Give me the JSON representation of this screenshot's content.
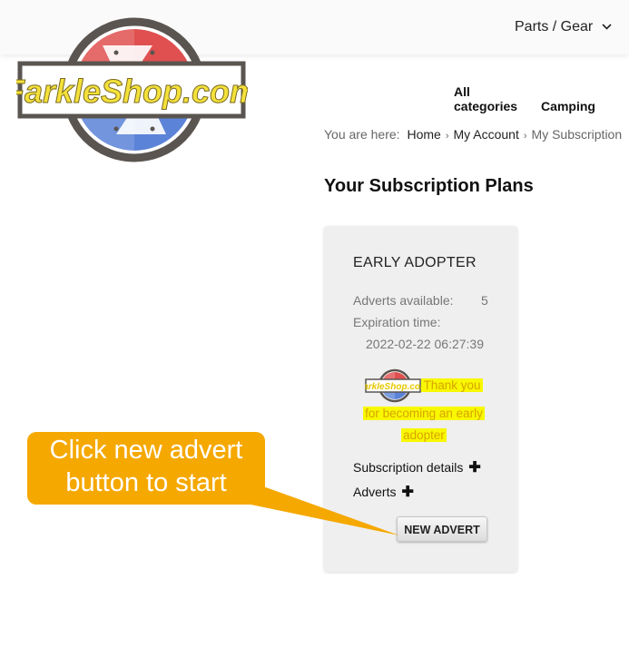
{
  "header": {
    "menu_label": "Parts / Gear",
    "chevron_icon": "chevron-down-icon"
  },
  "logo": {
    "text": "FarkleShop.com"
  },
  "nav": {
    "items": [
      "All categories",
      "Camping"
    ]
  },
  "breadcrumb": {
    "prefix": "You are here:",
    "items": [
      "Home",
      "My Account",
      "My Subscription"
    ]
  },
  "page_title": "Your Subscription Plans",
  "plan": {
    "name": "EARLY ADOPTER",
    "adverts_label": "Adverts available:",
    "adverts_value": "5",
    "expiration_label": "Expiration time:",
    "expiration_value": "2022-02-22 06:27:39",
    "thanks_line1": "Thank you",
    "thanks_line2": "for becoming an early",
    "thanks_line3": "adopter",
    "details_label": "Subscription details",
    "adverts_toggle_label": "Adverts",
    "new_advert_button": "NEW ADVERT"
  },
  "callout": {
    "line1": "Click new advert",
    "line2": "button to start",
    "color": "#f5a800"
  },
  "colors": {
    "card_bg": "#efefef",
    "highlight": "#f8f800",
    "logo_red": "#e05050",
    "logo_blue": "#5b83d8",
    "logo_yellow": "#f4e13a"
  }
}
